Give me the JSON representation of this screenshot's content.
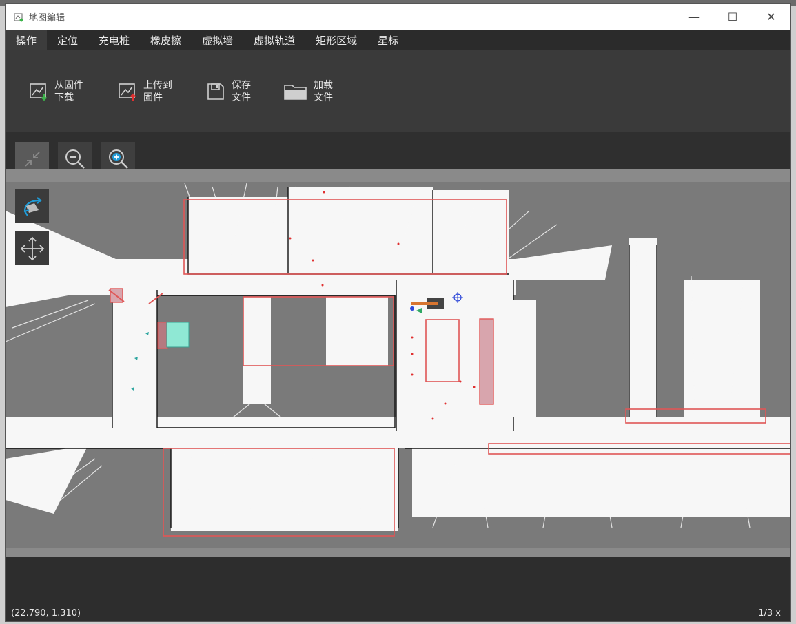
{
  "window": {
    "title": "地图编辑"
  },
  "window_controls": {
    "minimize": "—",
    "maximize": "☐",
    "close": "✕"
  },
  "menu": [
    "操作",
    "定位",
    "充电桩",
    "橡皮擦",
    "虚拟墙",
    "虚拟轨道",
    "矩形区域",
    "星标"
  ],
  "menu_active": 0,
  "toolbar": {
    "download": {
      "line1": "从固件",
      "line2": "下载"
    },
    "upload": {
      "line1": "上传到",
      "line2": "固件"
    },
    "save": {
      "line1": "保存",
      "line2": "文件"
    },
    "load": {
      "line1": "加载",
      "line2": "文件"
    }
  },
  "zoom_tools": [
    "fit-icon",
    "zoom-out-icon",
    "zoom-in-icon"
  ],
  "side_tools": [
    "rotate-map-icon",
    "move-icon"
  ],
  "status": {
    "coord": "(22.790, 1.310)",
    "page": "1/3 x"
  },
  "colors": {
    "accent": "#1f9bd7",
    "zone": "#e05656",
    "window_bg": "#2f2f2f",
    "map_free": "#f7f7f7",
    "map_unknown": "#7a7a7a"
  }
}
